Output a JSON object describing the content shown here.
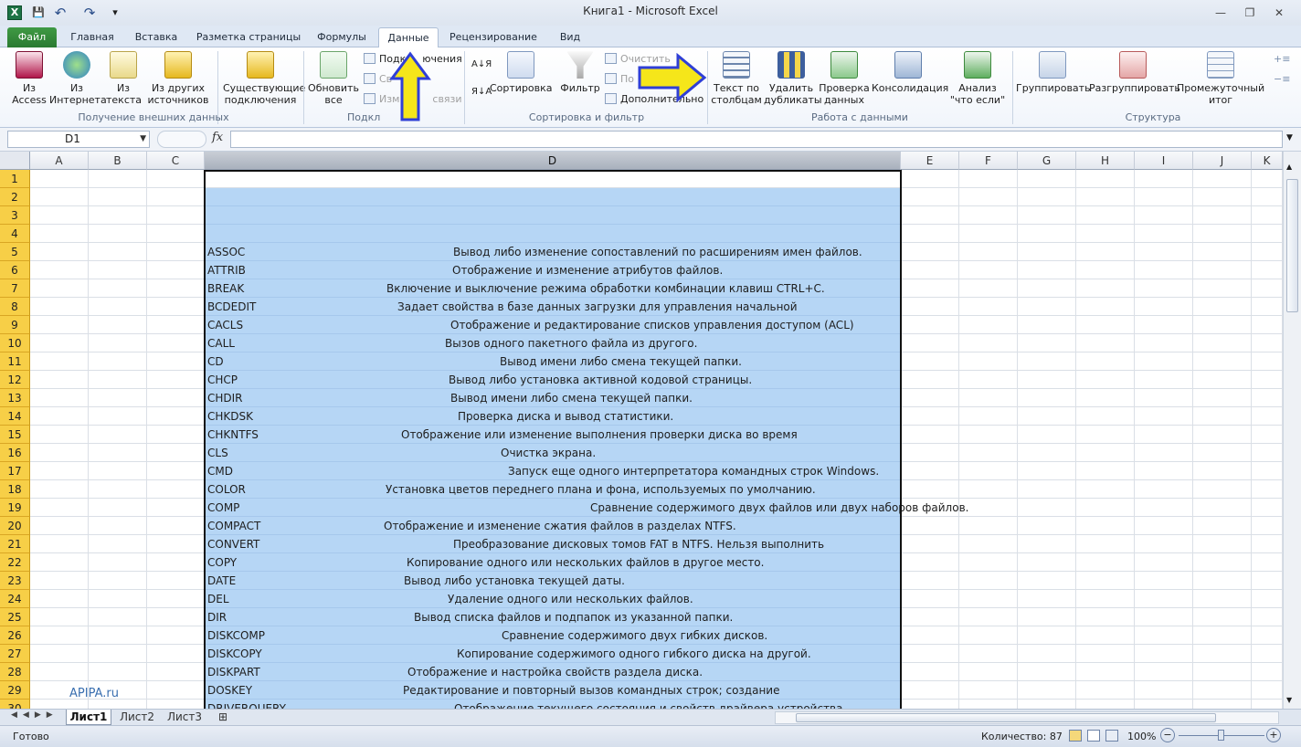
{
  "window": {
    "title": "Книга1  -  Microsoft Excel"
  },
  "qat": {
    "excel_icon": "X",
    "save": "💾",
    "undo": "↶",
    "redo": "↷",
    "customize": "▾"
  },
  "tabs": [
    "Файл",
    "Главная",
    "Вставка",
    "Разметка страницы",
    "Формулы",
    "Данные",
    "Рецензирование",
    "Вид"
  ],
  "active_tab": "Данные",
  "ribbon": {
    "get_external": {
      "group_label": "Получение внешних данных",
      "btn_access": "Из Access",
      "btn_web": "Из Интернета",
      "btn_text": "Из текста",
      "btn_other": "Из других источников",
      "btn_existing": "Существующие подключения"
    },
    "connections": {
      "group_label": "Подключения",
      "group_label_visible": "Подкл",
      "btn_refresh": "Обновить все",
      "connections": "Подключения",
      "connections_visible": "Подк",
      "connections_tail": "ючения",
      "properties": "Св",
      "edit_links": "Изм",
      "edit_links_tail": "связи"
    },
    "sort_filter": {
      "group_label": "Сортировка и фильтр",
      "sort_az": "А↓Я",
      "sort_za": "Я↓А",
      "btn_sort": "Сортировка",
      "btn_filter": "Фильтр",
      "clear": "Очистить",
      "reapply": "По",
      "advanced": "Дополнительно"
    },
    "data_tools": {
      "group_label": "Работа с данными",
      "btn_text_columns": "Текст по столбцам",
      "btn_remove_dup": "Удалить дубликаты",
      "btn_validation": "Проверка данных",
      "btn_consolidate": "Консолидация",
      "btn_whatif": "Анализ \"что если\""
    },
    "outline": {
      "group_label": "Структура",
      "btn_group": "Группировать",
      "btn_ungroup": "Разгруппировать",
      "btn_subtotal": "Промежуточный итог"
    }
  },
  "formula_bar": {
    "name_box": "D1",
    "fx": "fx",
    "value": ""
  },
  "columns": [
    "A",
    "B",
    "C",
    "D",
    "E",
    "F",
    "G",
    "H",
    "I",
    "J",
    "K"
  ],
  "rows": [
    "1",
    "2",
    "3",
    "4",
    "5",
    "6",
    "7",
    "8",
    "9",
    "10",
    "11",
    "12",
    "13",
    "14",
    "15",
    "16",
    "17",
    "18",
    "19",
    "20",
    "21",
    "22",
    "23",
    "24",
    "25",
    "26",
    "27",
    "28",
    "29",
    "30"
  ],
  "cells": [
    {
      "row": 5,
      "cmd": "ASSOC",
      "desc": "Вывод либо изменение сопоставлений по расширениям имен файлов."
    },
    {
      "row": 6,
      "cmd": "ATTRIB",
      "desc": "Отображение и изменение атрибутов файлов."
    },
    {
      "row": 7,
      "cmd": "BREAK",
      "desc": "Включение и выключение режима обработки комбинации клавиш CTRL+C."
    },
    {
      "row": 8,
      "cmd": "BCDEDIT",
      "desc": "Задает свойства в базе данных загрузки для управления начальной"
    },
    {
      "row": 9,
      "cmd": "CACLS",
      "desc": "Отображение и редактирование списков управления доступом (ACL)"
    },
    {
      "row": 10,
      "cmd": "CALL",
      "desc": "Вызов одного пакетного файла из другого."
    },
    {
      "row": 11,
      "cmd": "CD",
      "desc": "Вывод имени либо смена текущей папки."
    },
    {
      "row": 12,
      "cmd": "CHCP",
      "desc": "Вывод либо установка активной кодовой страницы."
    },
    {
      "row": 13,
      "cmd": "CHDIR",
      "desc": "Вывод имени либо смена текущей папки."
    },
    {
      "row": 14,
      "cmd": "CHKDSK",
      "desc": "Проверка диска и вывод статистики."
    },
    {
      "row": 15,
      "cmd": "CHKNTFS",
      "desc": "Отображение или изменение выполнения проверки диска во время"
    },
    {
      "row": 16,
      "cmd": "CLS",
      "desc": "Очистка экрана."
    },
    {
      "row": 17,
      "cmd": "CMD",
      "desc": "Запуск еще одного интерпретатора командных строк Windows."
    },
    {
      "row": 18,
      "cmd": "COLOR",
      "desc": "Установка цветов переднего плана и фона, используемых по умолчанию."
    },
    {
      "row": 19,
      "cmd": "COMP",
      "desc": "Сравнение содержимого двух файлов или двух наборов файлов."
    },
    {
      "row": 20,
      "cmd": "COMPACT",
      "desc": "Отображение и изменение сжатия файлов в разделах NTFS."
    },
    {
      "row": 21,
      "cmd": "CONVERT",
      "desc": "Преобразование дисковых томов FAT в NTFS. Нельзя выполнить"
    },
    {
      "row": 22,
      "cmd": "COPY",
      "desc": "Копирование одного или нескольких файлов в другое место."
    },
    {
      "row": 23,
      "cmd": "DATE",
      "desc": "Вывод либо установка текущей даты."
    },
    {
      "row": 24,
      "cmd": "DEL",
      "desc": "Удаление одного или нескольких файлов."
    },
    {
      "row": 25,
      "cmd": "DIR",
      "desc": "Вывод списка файлов и подпапок из указанной папки."
    },
    {
      "row": 26,
      "cmd": "DISKCOMP",
      "desc": "Сравнение содержимого двух гибких дисков."
    },
    {
      "row": 27,
      "cmd": "DISKCOPY",
      "desc": "Копирование содержимого одного гибкого диска на другой."
    },
    {
      "row": 28,
      "cmd": "DISKPART",
      "desc": "Отображение и настройка свойств раздела диска."
    },
    {
      "row": 29,
      "cmd": "DOSKEY",
      "desc": "Редактирование и повторный вызов командных строк; создание"
    },
    {
      "row": 30,
      "cmd": "DRIVERQUERY",
      "desc": "Отображение текущего состояния и свойств драйвера устройства."
    }
  ],
  "watermark": "APIPA.ru",
  "sheets": [
    "Лист1",
    "Лист2",
    "Лист3"
  ],
  "status": {
    "ready": "Готово",
    "count": "Количество: 87",
    "zoom": "100%"
  },
  "colors": {
    "accent": "#2a7a31",
    "selection": "#b6d6f5",
    "row_header": "#f7cf47",
    "arrow": "#f5e61a",
    "arrow_outline": "#2f3fd6"
  }
}
